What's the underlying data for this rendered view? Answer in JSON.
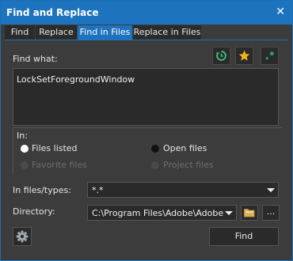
{
  "window": {
    "title": "Find and Replace",
    "close_glyph": "✕"
  },
  "tabs": [
    {
      "label": "Find",
      "active": false
    },
    {
      "label": "Replace",
      "active": false
    },
    {
      "label": "Find in Files",
      "active": true
    },
    {
      "label": "Replace in Files",
      "active": false
    }
  ],
  "find": {
    "label": "Find what:",
    "value": "LockSetForegroundWindow"
  },
  "toolbar_icons": [
    "history-icon",
    "favorite-star-icon",
    "regex-icon"
  ],
  "in_section": {
    "label": "In:",
    "options": [
      {
        "label": "Files listed",
        "selected": true,
        "enabled": true
      },
      {
        "label": "Open files",
        "selected": false,
        "enabled": true
      },
      {
        "label": "Favorite files",
        "selected": false,
        "enabled": false
      },
      {
        "label": "Project files",
        "selected": false,
        "enabled": false
      }
    ]
  },
  "file_types": {
    "label": "In files/types:",
    "value": "*.*"
  },
  "directory": {
    "label": "Directory:",
    "value": "C:\\Program Files\\Adobe\\Adobe InC",
    "browse_label": "..."
  },
  "buttons": {
    "find": "Find"
  },
  "colors": {
    "accent": "#1e73be",
    "background": "#3c3c3c",
    "field": "#2a2a2a",
    "history_icon": "#3fbf7f",
    "star_icon": "#f2b21b",
    "regex_icon": "#2aa876"
  }
}
